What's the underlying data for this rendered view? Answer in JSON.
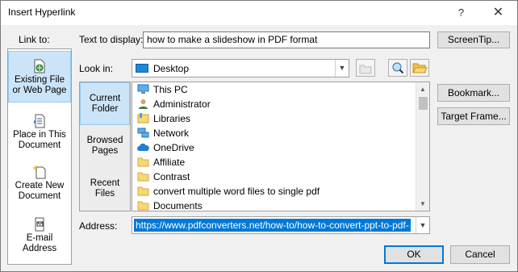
{
  "window": {
    "title": "Insert Hyperlink",
    "help": "?",
    "close": "✕"
  },
  "link_to": {
    "label": "Link to:",
    "items": [
      {
        "line1": "Existing File",
        "line2": "or Web Page",
        "icon": "globe-file-icon"
      },
      {
        "line1": "Place in This",
        "line2": "Document",
        "icon": "document-place-icon"
      },
      {
        "line1": "Create New",
        "line2": "Document",
        "icon": "new-document-icon"
      },
      {
        "line1": "E-mail",
        "line2": "Address",
        "icon": "email-icon"
      }
    ]
  },
  "text_display": {
    "label": "Text to display:",
    "value": "how to make a slideshow in PDF format"
  },
  "buttons": {
    "screentip": "ScreenTip...",
    "bookmark": "Bookmark...",
    "target_frame": "Target Frame...",
    "ok": "OK",
    "cancel": "Cancel"
  },
  "look_in": {
    "label": "Look in:",
    "value": "Desktop"
  },
  "nav": [
    {
      "line1": "Current",
      "line2": "Folder"
    },
    {
      "line1": "Browsed",
      "line2": "Pages"
    },
    {
      "line1": "Recent",
      "line2": "Files"
    }
  ],
  "files": [
    {
      "name": "This PC",
      "icon": "computer-icon"
    },
    {
      "name": "Administrator",
      "icon": "user-icon"
    },
    {
      "name": "Libraries",
      "icon": "libraries-icon"
    },
    {
      "name": "Network",
      "icon": "network-icon"
    },
    {
      "name": "OneDrive",
      "icon": "cloud-icon"
    },
    {
      "name": "Affiliate",
      "icon": "folder-icon"
    },
    {
      "name": "Contrast",
      "icon": "folder-icon"
    },
    {
      "name": "convert multiple word files to single pdf",
      "icon": "folder-icon"
    },
    {
      "name": "Documents",
      "icon": "folder-icon"
    }
  ],
  "address": {
    "label": "Address:",
    "value": "https://www.pdfconverters.net/how-to/how-to-convert-ppt-to-pdf-"
  },
  "colors": {
    "accent": "#0078d7",
    "selection": "#cce4f7",
    "folder": "#f8d775"
  }
}
